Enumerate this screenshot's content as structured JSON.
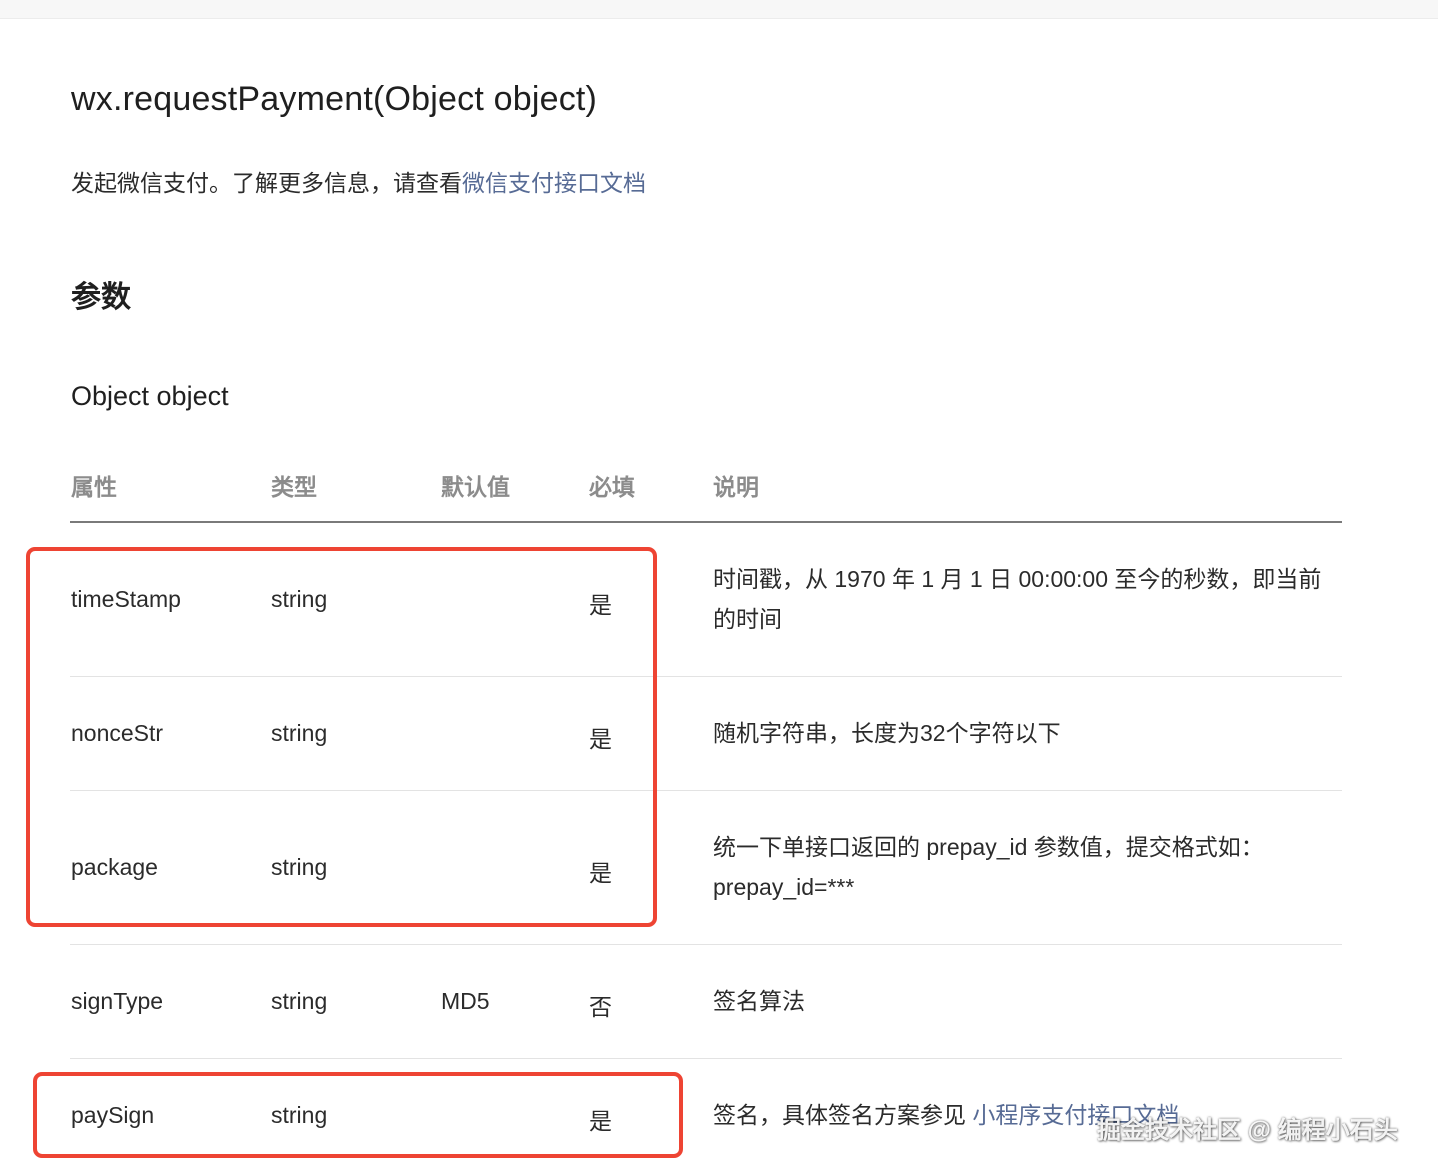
{
  "api": {
    "title": "wx.requestPayment(Object object)",
    "description_prefix": "发起微信支付。了解更多信息，请查看",
    "description_link": "微信支付接口文档"
  },
  "sections": {
    "params_heading": "参数",
    "object_heading": "Object object"
  },
  "table": {
    "headers": [
      "属性",
      "类型",
      "默认值",
      "必填",
      "说明"
    ],
    "rows": [
      {
        "name": "timeStamp",
        "type": "string",
        "default": "",
        "required": "是",
        "desc": "时间戳，从 1970 年 1 月 1 日 00:00:00 至今的秒数，即当前的时间",
        "desc_link": ""
      },
      {
        "name": "nonceStr",
        "type": "string",
        "default": "",
        "required": "是",
        "desc": "随机字符串，长度为32个字符以下",
        "desc_link": ""
      },
      {
        "name": "package",
        "type": "string",
        "default": "",
        "required": "是",
        "desc": "统一下单接口返回的 prepay_id 参数值，提交格式如：prepay_id=***",
        "desc_link": ""
      },
      {
        "name": "signType",
        "type": "string",
        "default": "MD5",
        "required": "否",
        "desc": "签名算法",
        "desc_link": ""
      },
      {
        "name": "paySign",
        "type": "string",
        "default": "",
        "required": "是",
        "desc": "签名，具体签名方案参见 ",
        "desc_link": "小程序支付接口文档"
      }
    ]
  },
  "annotation": {
    "highlight_color": "#ee4433"
  },
  "watermark": "掘金技术社区 @ 编程小石头",
  "colors": {
    "link": "#576b95",
    "header_text": "#8c8c8c",
    "body_text": "#2b2b2b"
  }
}
